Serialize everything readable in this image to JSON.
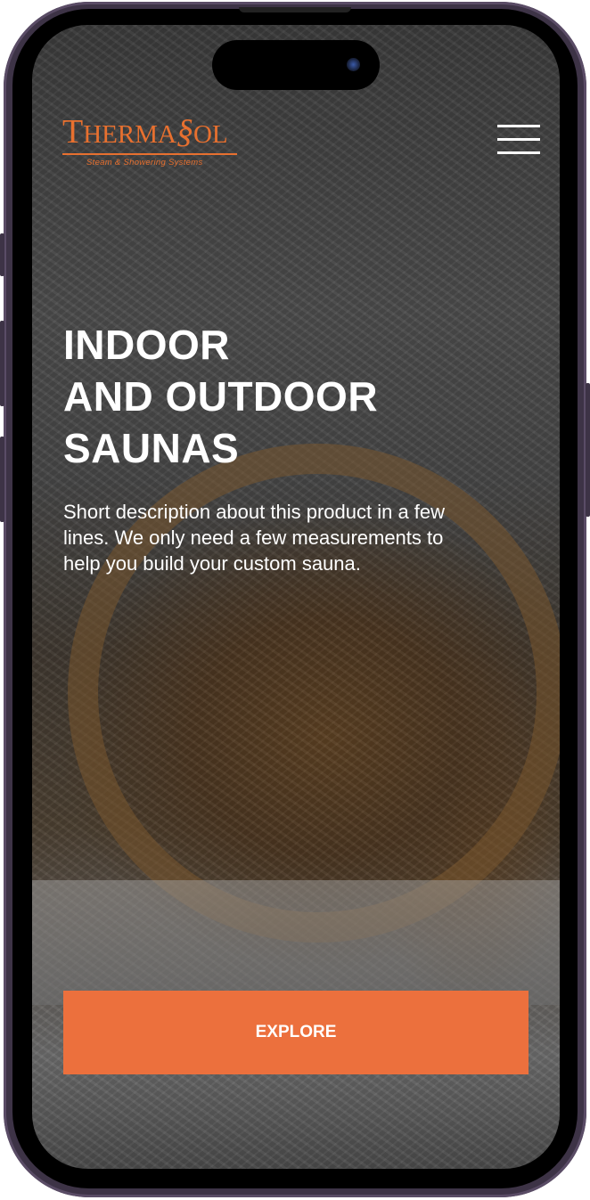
{
  "logo": {
    "brand": "ThermaSol",
    "tagline": "Steam & Showering Systems",
    "color": "#e8702f"
  },
  "hero": {
    "title_lines": [
      "INDOOR",
      "AND OUTDOOR",
      "SAUNAS"
    ],
    "description": "Short description about this product in a few lines. We only need a few measurements to help you build your custom sauna."
  },
  "cta": {
    "label": "EXPLORE",
    "color": "#ec703d"
  }
}
